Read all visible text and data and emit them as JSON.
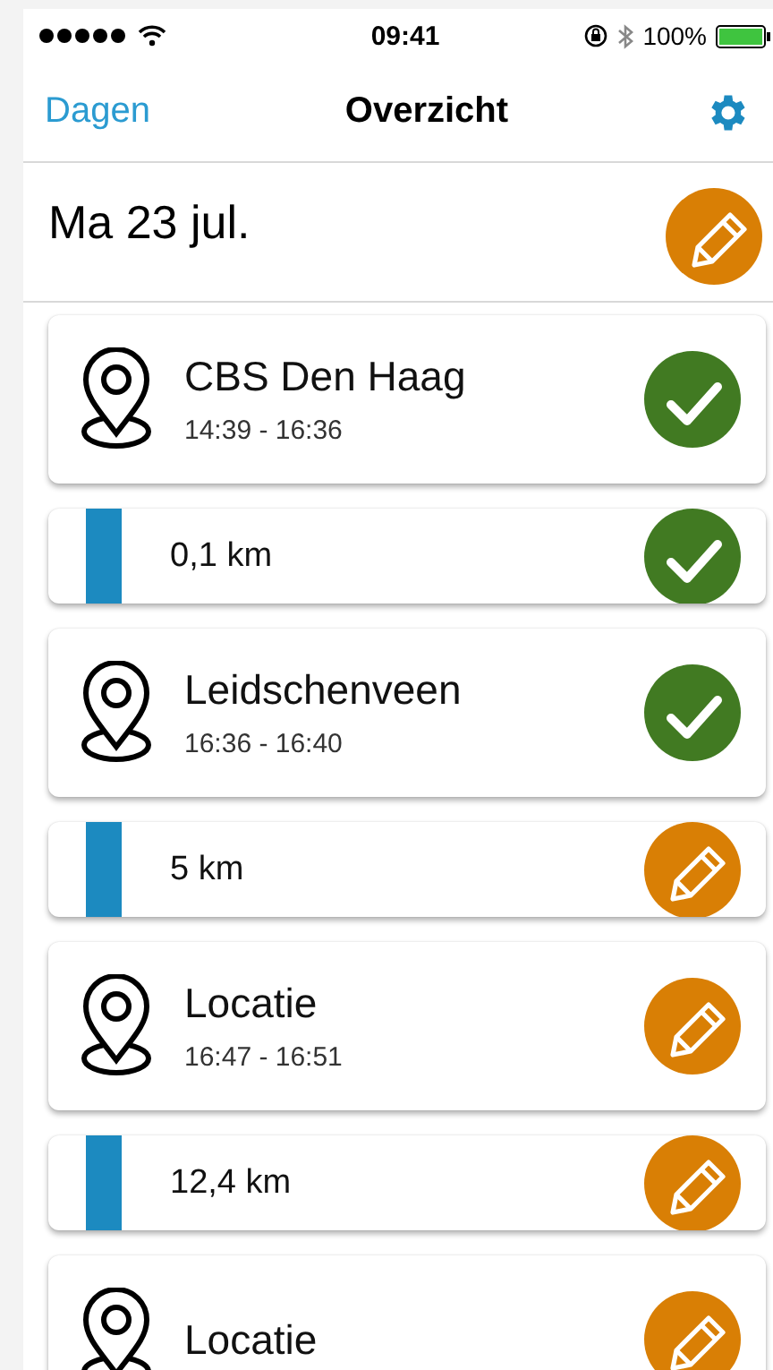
{
  "status_bar": {
    "time": "09:41",
    "battery": "100%"
  },
  "nav": {
    "back": "Dagen",
    "title": "Overzicht"
  },
  "day": {
    "date": "Ma 23 jul.",
    "confirmed": false
  },
  "items": [
    {
      "kind": "stop",
      "name": "CBS Den Haag",
      "time": "14:39 - 16:36",
      "confirmed": true
    },
    {
      "kind": "trip",
      "distance": "0,1 km",
      "confirmed": true
    },
    {
      "kind": "stop",
      "name": "Leidschenveen",
      "time": "16:36 - 16:40",
      "confirmed": true
    },
    {
      "kind": "trip",
      "distance": "5 km",
      "confirmed": false
    },
    {
      "kind": "stop",
      "name": "Locatie",
      "time": "16:47 - 16:51",
      "confirmed": false
    },
    {
      "kind": "trip",
      "distance": "12,4 km",
      "confirmed": false
    },
    {
      "kind": "stop",
      "name": "Locatie",
      "confirmed": false
    }
  ]
}
